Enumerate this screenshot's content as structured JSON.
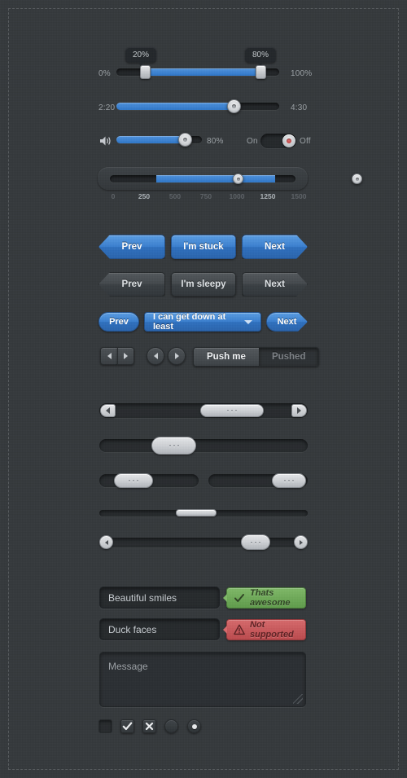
{
  "sliders": {
    "dual_percent": {
      "name": "dual-range-percent",
      "min_label": "0%",
      "max_label": "100%",
      "low_bubble": "20%",
      "high_bubble": "80%",
      "low_value": 20,
      "high_value": 80
    },
    "time": {
      "name": "time-slider",
      "min_label": "2:20",
      "max_label": "4:30",
      "value": 62
    },
    "volume": {
      "name": "volume-slider",
      "icon": "speaker-icon",
      "value_label": "80%",
      "value": 80
    },
    "toggle": {
      "name": "on-off-toggle",
      "on_label": "On",
      "off_label": "Off",
      "state": "off"
    },
    "ticked_range": {
      "name": "ticked-range-slider",
      "ticks": [
        "0",
        "250",
        "500",
        "750",
        "1000",
        "1250",
        "1500"
      ],
      "active_ticks": [
        "250",
        "1250"
      ],
      "low_value": 250,
      "high_value": 1250,
      "min": 0,
      "max": 1500
    }
  },
  "buttons": {
    "blue_row": [
      {
        "name": "prev-button-blue",
        "label": "Prev",
        "shape": "prev"
      },
      {
        "name": "im-stuck-button",
        "label": "I'm stuck",
        "shape": "flat"
      },
      {
        "name": "next-button-blue",
        "label": "Next",
        "shape": "next"
      }
    ],
    "gray_row": [
      {
        "name": "prev-button-gray",
        "label": "Prev",
        "shape": "prev"
      },
      {
        "name": "im-sleepy-button",
        "label": "I'm sleepy",
        "shape": "flat"
      },
      {
        "name": "next-button-gray",
        "label": "Next",
        "shape": "next"
      }
    ],
    "pill_row": {
      "prev_label": "Prev",
      "next_label": "Next",
      "dropdown_label": "I can get down at least",
      "dropdown_icon": "chevron-down-icon"
    },
    "arrow_groups": {
      "square_pair": {
        "left_icon": "triangle-left-icon",
        "right_icon": "triangle-right-icon"
      },
      "round_pair": {
        "left_icon": "triangle-left-icon",
        "right_icon": "triangle-right-icon"
      }
    },
    "segmented": {
      "name": "push-segmented-control",
      "items": [
        {
          "label": "Push me",
          "state": "up"
        },
        {
          "label": "Pushed",
          "state": "down"
        }
      ]
    }
  },
  "scrollbars": [
    {
      "name": "scrollbar-with-arrows-wide",
      "has_arrows": true,
      "thumb_percent": 38,
      "thumb_offset_percent": 40
    },
    {
      "name": "scrollbar-plain-wide",
      "has_arrows": false,
      "thumb_percent": 25,
      "thumb_offset_percent": 26
    },
    {
      "name": "scrollbar-short-left",
      "has_arrows": false,
      "thumb_percent": 31,
      "thumb_offset_percent": 8
    },
    {
      "name": "scrollbar-short-right",
      "has_arrows": false,
      "thumb_percent": 31,
      "thumb_offset_percent": 69
    },
    {
      "name": "scrollbar-thin-flat",
      "has_arrows": false,
      "thumb_percent": 18,
      "thumb_offset_percent": 38
    },
    {
      "name": "scrollbar-round-arrows",
      "has_arrows": true,
      "thumb_percent": 16,
      "thumb_offset_percent": 71
    }
  ],
  "form": {
    "input_ok": {
      "name": "beautiful-smiles-input",
      "value": "Beautiful smiles",
      "placeholder": "Beautiful smiles"
    },
    "tooltip_ok": {
      "name": "success-tooltip",
      "text": "Thats awesome",
      "icon": "check-icon",
      "color": "#7eb867"
    },
    "input_err": {
      "name": "duck-faces-input",
      "value": "Duck faces",
      "placeholder": "Duck faces"
    },
    "tooltip_err": {
      "name": "error-tooltip",
      "text": "Not supported",
      "icon": "warning-triangle-icon",
      "color": "#d6696b"
    },
    "textarea": {
      "name": "message-textarea",
      "placeholder": "Message",
      "value": ""
    },
    "toggles": [
      {
        "name": "checkbox-empty",
        "type": "checkbox",
        "state": "empty"
      },
      {
        "name": "checkbox-checked",
        "type": "checkbox",
        "state": "checked",
        "icon": "check-icon"
      },
      {
        "name": "checkbox-crossed",
        "type": "checkbox",
        "state": "crossed",
        "icon": "cross-icon"
      },
      {
        "name": "radio-empty",
        "type": "radio",
        "state": "empty"
      },
      {
        "name": "radio-selected",
        "type": "radio",
        "state": "selected"
      }
    ]
  },
  "theme": {
    "background": "#35393c",
    "accent_blue": "#3b80cf",
    "success_green": "#7eb867",
    "error_red": "#d6696b"
  }
}
